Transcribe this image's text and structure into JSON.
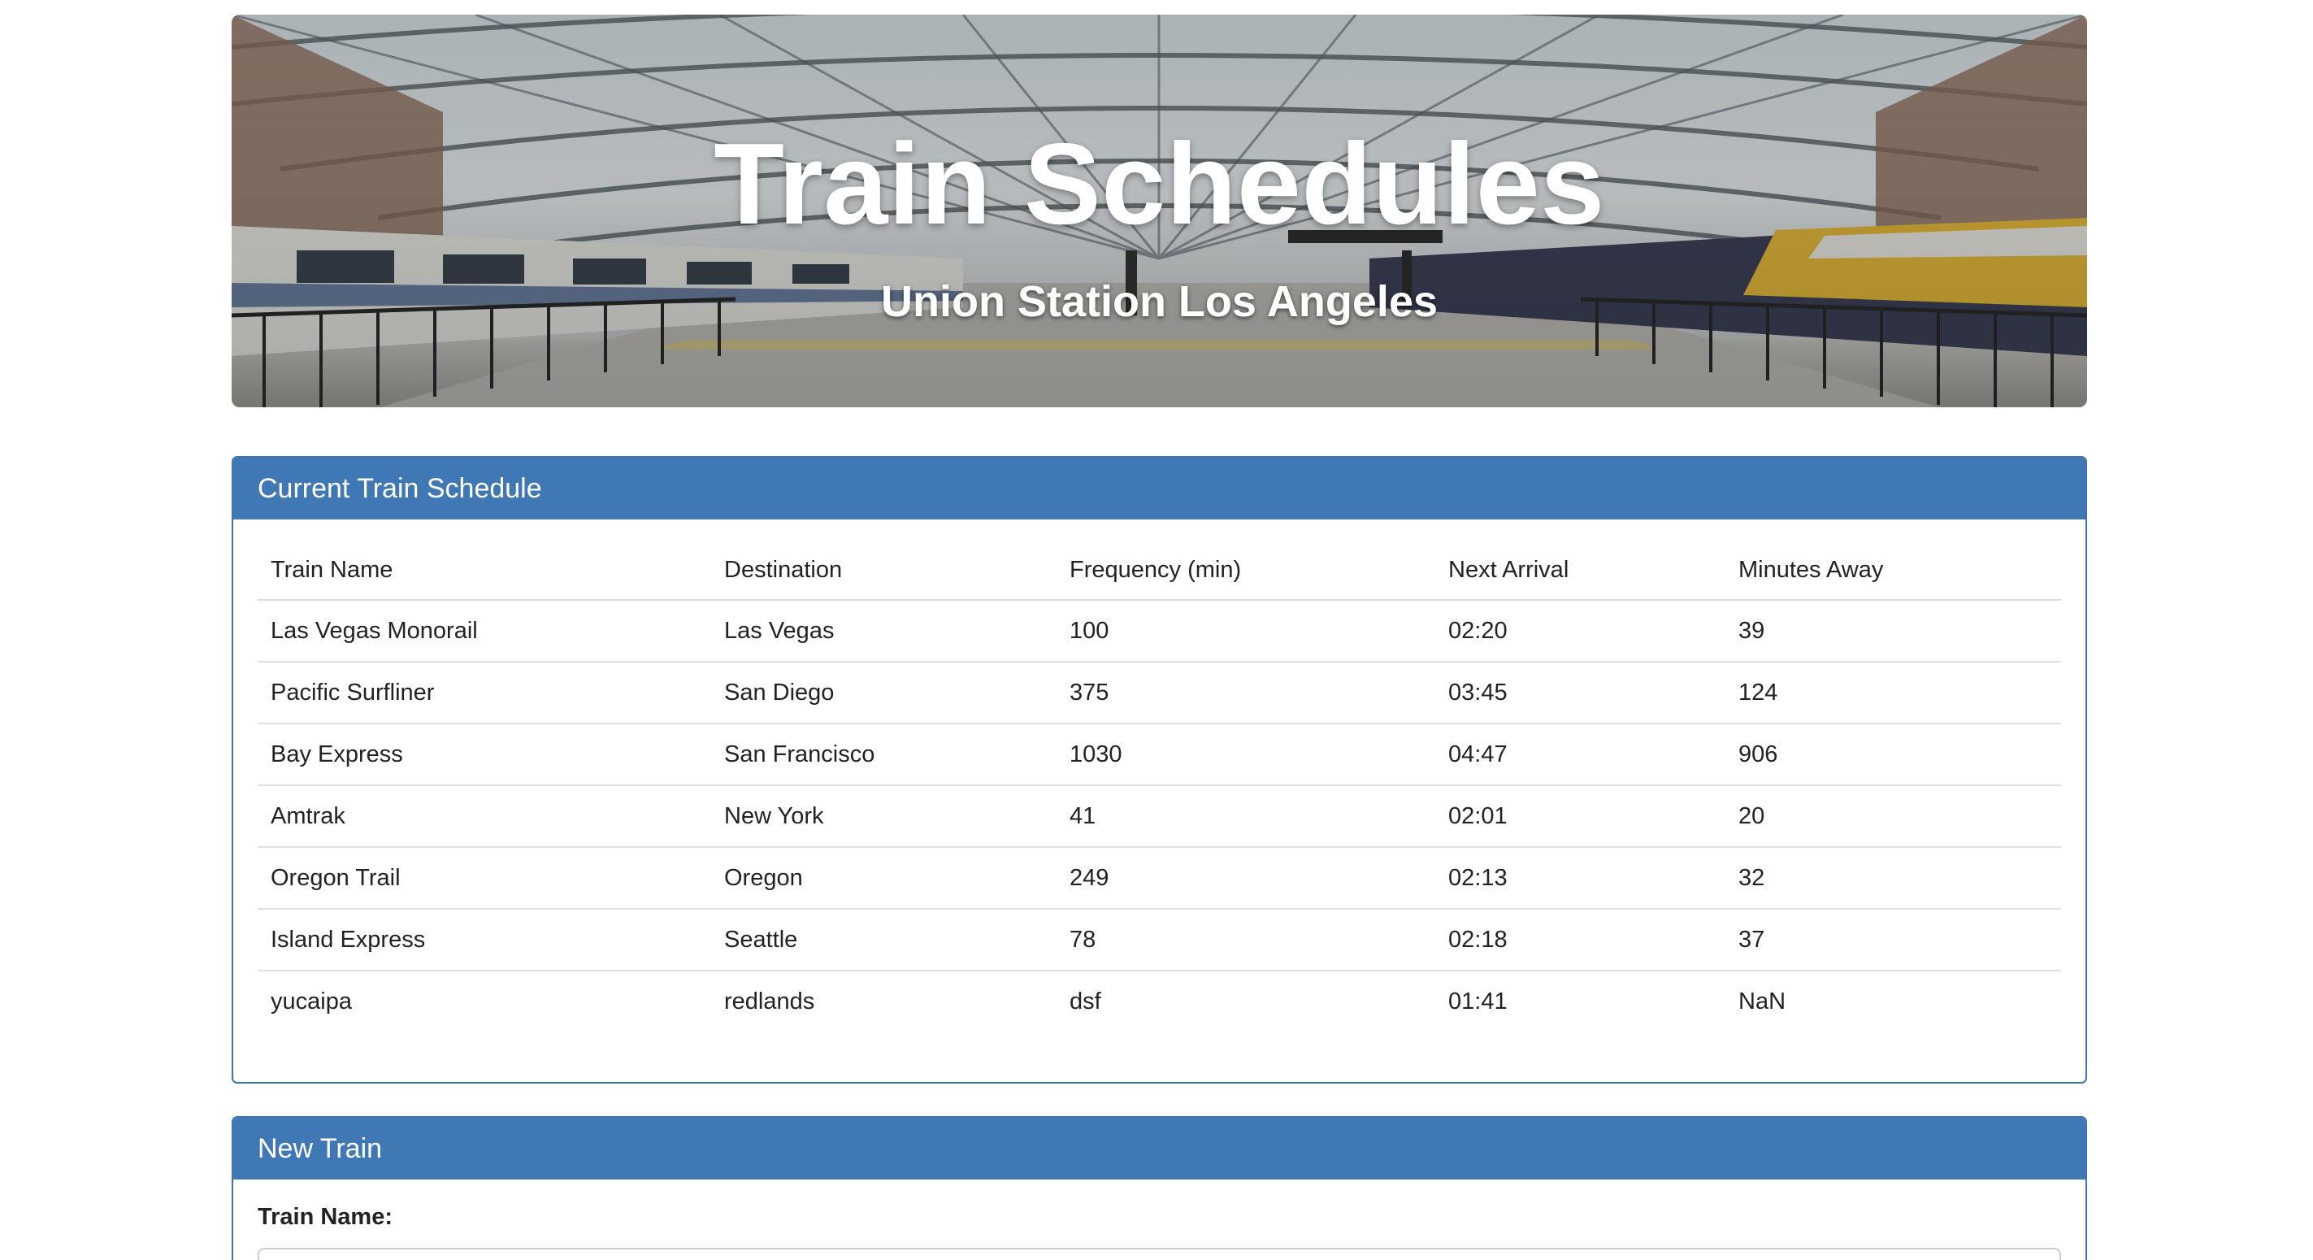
{
  "hero": {
    "title": "Train Schedules",
    "subtitle": "Union Station Los Angeles",
    "background_image": "train-station-platform-photo"
  },
  "schedule": {
    "heading": "Current Train Schedule",
    "columns": [
      "Train Name",
      "Destination",
      "Frequency (min)",
      "Next Arrival",
      "Minutes Away"
    ],
    "rows": [
      [
        "Las Vegas Monorail",
        "Las Vegas",
        "100",
        "02:20",
        "39"
      ],
      [
        "Pacific Surfliner",
        "San Diego",
        "375",
        "03:45",
        "124"
      ],
      [
        "Bay Express",
        "San Francisco",
        "1030",
        "04:47",
        "906"
      ],
      [
        "Amtrak",
        "New York",
        "41",
        "02:01",
        "20"
      ],
      [
        "Oregon Trail",
        "Oregon",
        "249",
        "02:13",
        "32"
      ],
      [
        "Island Express",
        "Seattle",
        "78",
        "02:18",
        "37"
      ],
      [
        "yucaipa",
        "redlands",
        "dsf",
        "01:41",
        "NaN"
      ]
    ]
  },
  "new_train": {
    "heading": "New Train",
    "train_name_label": "Train Name:",
    "train_name_value": "",
    "train_name_placeholder": ""
  },
  "colors": {
    "panel_heading": "#4078b5",
    "panel_border": "#3e75ae",
    "text": "#222222"
  }
}
